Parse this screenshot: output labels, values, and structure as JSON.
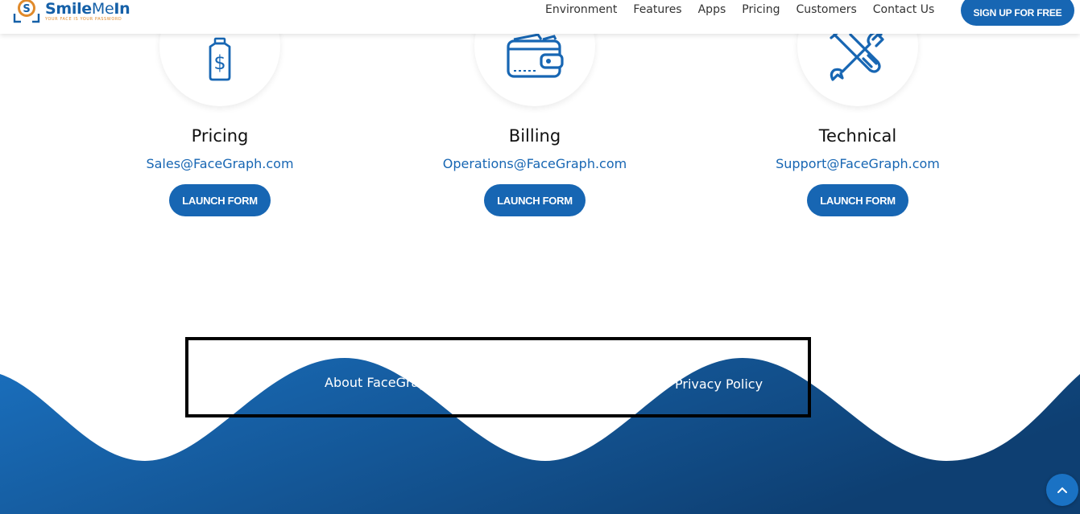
{
  "header": {
    "logo_name_bold": "Smile",
    "logo_name_light": "Me",
    "logo_name_bold2": "In",
    "logo_tagline": "YOUR FACE IS YOUR PASSWORD",
    "nav": [
      "Environment",
      "Features",
      "Apps",
      "Pricing",
      "Customers",
      "Contact Us"
    ],
    "signup_label": "SIGN UP FOR FREE"
  },
  "contacts": [
    {
      "title": "Pricing",
      "email": "Sales@FaceGraph.com",
      "button": "LAUNCH FORM",
      "icon": "price-tag-icon"
    },
    {
      "title": "Billing",
      "email": "Operations@FaceGraph.com",
      "button": "LAUNCH FORM",
      "icon": "wallet-icon"
    },
    {
      "title": "Technical",
      "email": "Support@FaceGraph.com",
      "button": "LAUNCH FORM",
      "icon": "tools-icon"
    }
  ],
  "footer": {
    "about_link": "About FaceGraph",
    "privacy_link": "Privacy Policy"
  },
  "colors": {
    "brand_blue": "#1766b3",
    "wave_light": "#1a6fbd",
    "wave_dark": "#0e3f72",
    "logo_accent": "#e08a2b"
  },
  "icons": {
    "back_to_top": "chevron-up-icon"
  }
}
